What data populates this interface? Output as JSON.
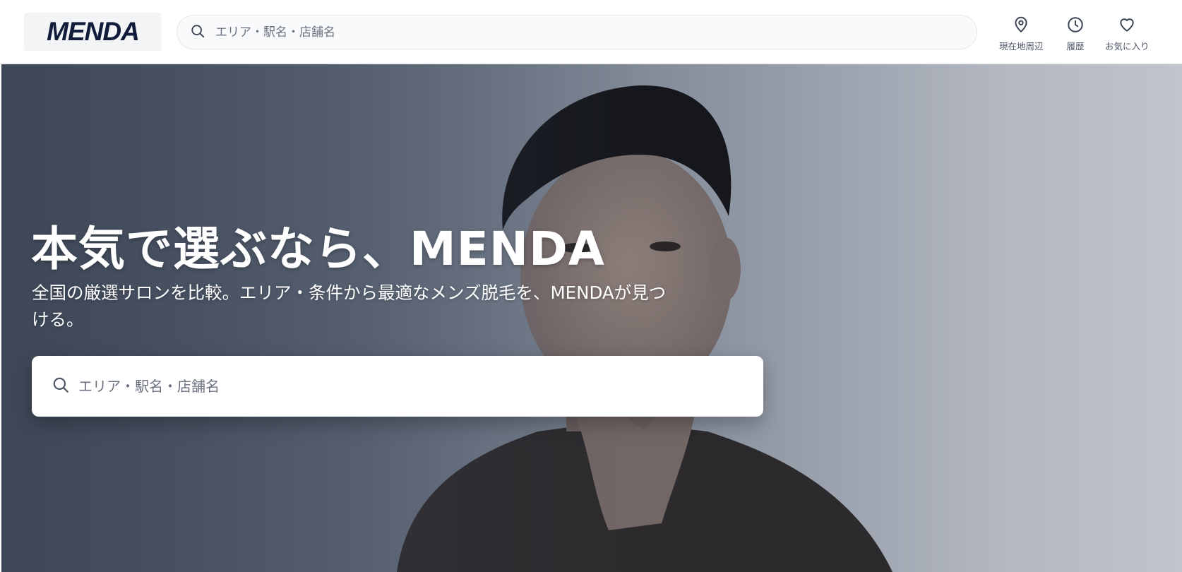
{
  "header": {
    "logo": "MENDA",
    "search": {
      "placeholder": "エリア・駅名・店舗名",
      "value": ""
    },
    "nav": {
      "nearby": "現在地周辺",
      "history": "履歴",
      "favorites": "お気に入り"
    }
  },
  "hero": {
    "title": "本気で選ぶなら、MENDA",
    "subtitle": "全国の厳選サロンを比較。エリア・条件から最適なメンズ脱毛を、MENDAが見つける。",
    "search": {
      "placeholder": "エリア・駅名・店舗名",
      "value": ""
    }
  },
  "colors": {
    "brand": "#111c3a",
    "hero_text": "#ffffff",
    "muted": "#4b5563"
  }
}
